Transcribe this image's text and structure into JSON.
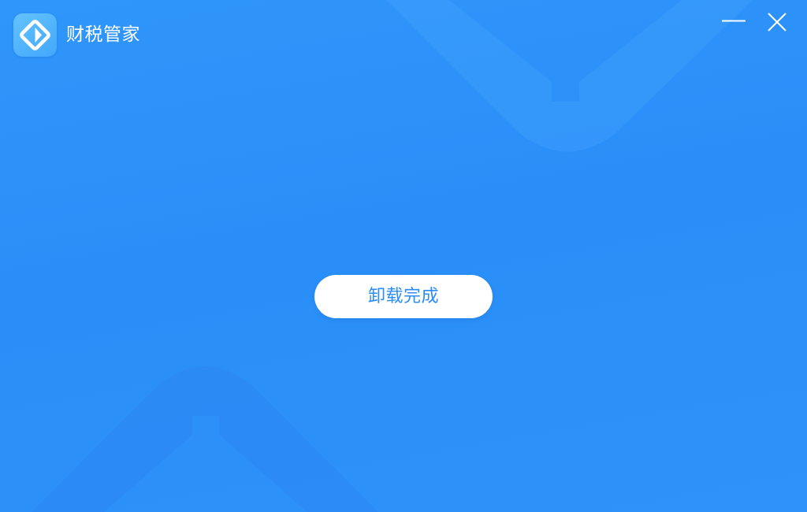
{
  "window": {
    "app_name": "财税管家",
    "logo_icon": "finance-app-logo-icon",
    "minimize_icon": "minimize-icon",
    "close_icon": "close-icon"
  },
  "main": {
    "done_button_label": "卸载完成"
  },
  "colors": {
    "background": "#2a8ef8",
    "button_background": "#ffffff",
    "button_text": "#2a8cf5",
    "title_text": "#ffffff"
  }
}
